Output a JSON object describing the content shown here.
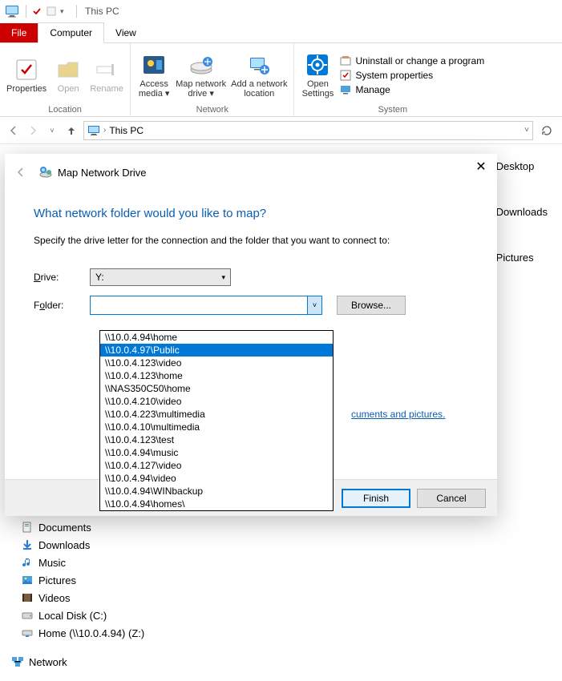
{
  "titlebar": {
    "title": "This PC"
  },
  "ribbon": {
    "tabs": {
      "file": "File",
      "computer": "Computer",
      "view": "View"
    },
    "location": {
      "label": "Location",
      "properties": "Properties",
      "open": "Open",
      "rename": "Rename"
    },
    "network": {
      "label": "Network",
      "access_media": "Access media",
      "map_drive": "Map network drive",
      "add_location": "Add a network location"
    },
    "system": {
      "label": "System",
      "open_settings": "Open Settings",
      "uninstall": "Uninstall or change a program",
      "properties": "System properties",
      "manage": "Manage"
    }
  },
  "addressbar": {
    "path": "This PC"
  },
  "right_locations": [
    "Desktop",
    "Downloads",
    "Pictures"
  ],
  "tree": {
    "items": [
      "Documents",
      "Downloads",
      "Music",
      "Pictures",
      "Videos",
      "Local Disk (C:)",
      "Home (\\\\10.0.4.94) (Z:)"
    ],
    "network": "Network"
  },
  "dialog": {
    "title": "Map Network Drive",
    "heading": "What network folder would you like to map?",
    "subtext": "Specify the drive letter for the connection and the folder that you want to connect to:",
    "drive_label_pre": "D",
    "drive_label_post": "rive:",
    "drive_value": "Y:",
    "folder_label_pre": "F",
    "folder_label_post": "older:",
    "folder_label_u": "o",
    "browse": "Browse...",
    "link_tail": "cuments and pictures",
    "finish": "Finish",
    "cancel": "Cancel",
    "dropdown": {
      "items": [
        "\\\\10.0.4.94\\home",
        "\\\\10.0.4.97\\Public",
        "\\\\10.0.4.123\\video",
        "\\\\10.0.4.123\\home",
        "\\\\NAS350C50\\home",
        "\\\\10.0.4.210\\video",
        "\\\\10.0.4.223\\multimedia",
        "\\\\10.0.4.10\\multimedia",
        "\\\\10.0.4.123\\test",
        "\\\\10.0.4.94\\music",
        "\\\\10.0.4.127\\video",
        "\\\\10.0.4.94\\video",
        "\\\\10.0.4.94\\WINbackup",
        "\\\\10.0.4.94\\homes\\"
      ],
      "selected_index": 1
    }
  }
}
